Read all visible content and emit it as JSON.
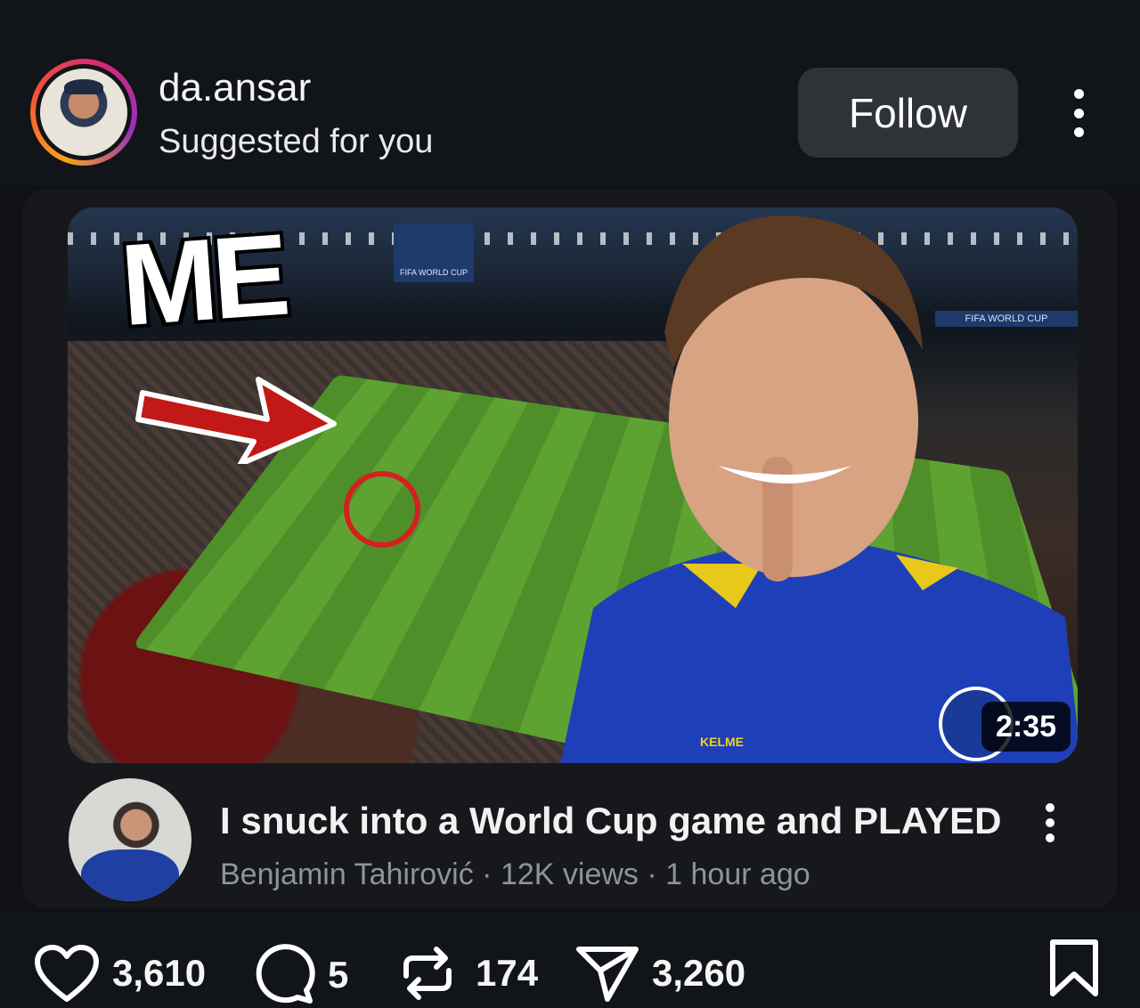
{
  "post": {
    "username": "da.ansar",
    "subtitle": "Suggested for you",
    "follow_label": "Follow"
  },
  "video": {
    "thumbnail_text": "ME",
    "duration": "2:35",
    "title": "I snuck into a World Cup game and PLAYED",
    "channel": "Benjamin Tahirović",
    "views": "12K views",
    "age": "1 hour ago",
    "meta_separator": " · ",
    "signage": {
      "top_banner": "FIFA WORLD CUP",
      "right_banner": "FIFA WORLD CUP",
      "shirt_brand": "KELME"
    }
  },
  "actions": {
    "likes": "3,610",
    "comments": "5",
    "reposts": "174",
    "shares": "3,260"
  },
  "icons": {
    "more": "more-vertical-icon",
    "like": "heart-icon",
    "comment": "comment-icon",
    "repost": "repost-icon",
    "share": "send-icon",
    "save": "bookmark-icon"
  },
  "colors": {
    "background": "#0f1115",
    "follow_button": "#2f3338",
    "meta_text": "#8f949b",
    "accent_red": "#d32020"
  }
}
